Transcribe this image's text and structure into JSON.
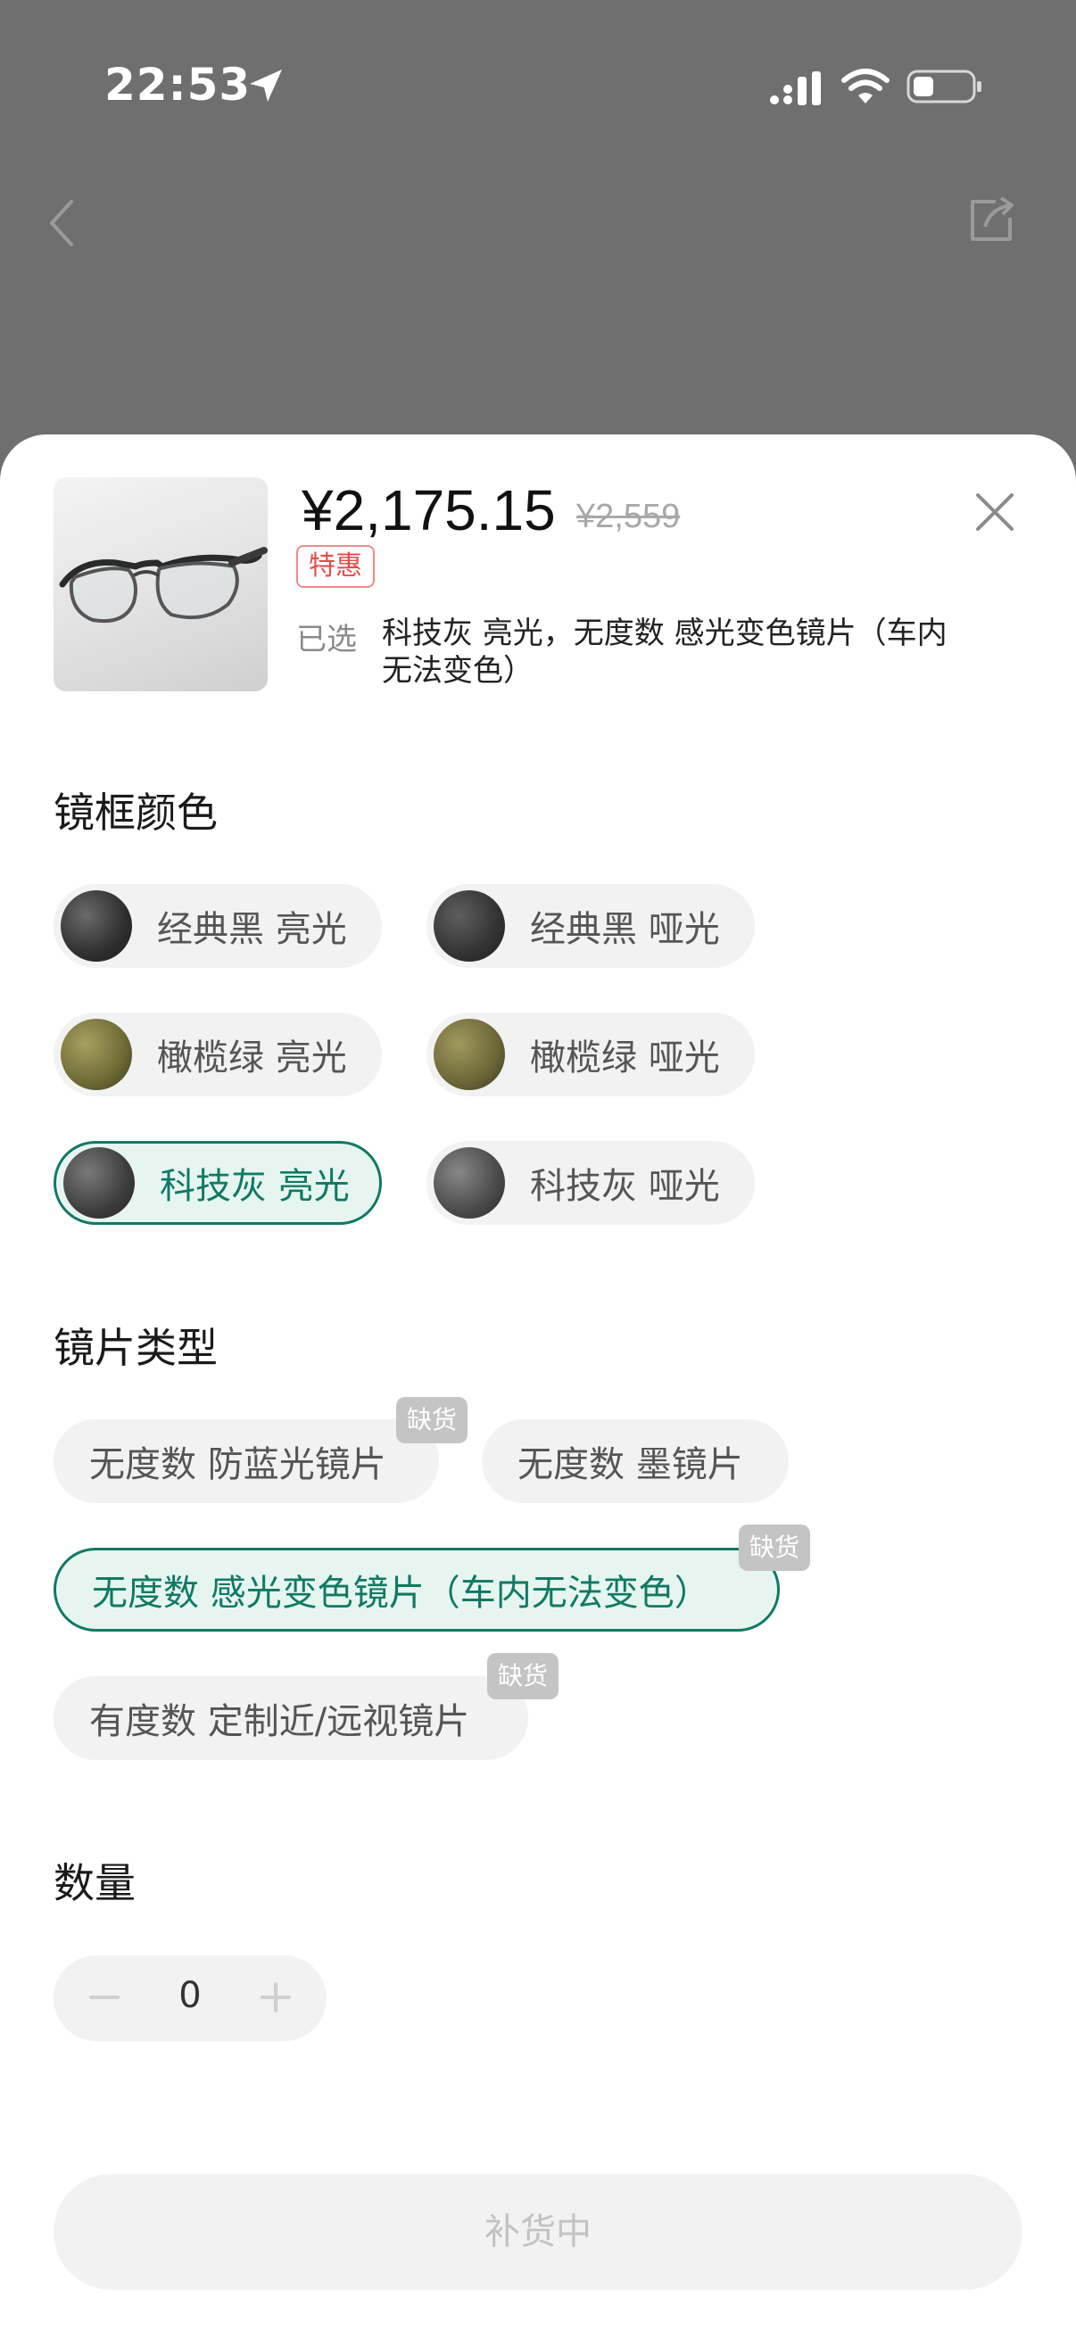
{
  "status_bar": {
    "time": "22:53"
  },
  "colors": {
    "accent": "#0f7a62",
    "accent_bg": "#e7f5f1",
    "deal": "#e84b4b",
    "overlay": "#6f6f6f"
  },
  "product": {
    "price": "¥2,175.15",
    "original_price": "¥2,559",
    "deal_badge": "特惠",
    "selected_label": "已选",
    "selected_value": "科技灰 亮光，无度数 感光变色镜片（车内无法变色）"
  },
  "frame_color": {
    "title": "镜框颜色",
    "options": [
      {
        "label": "经典黑 亮光",
        "swatch": "#2f2f2f",
        "selected": false
      },
      {
        "label": "经典黑 哑光",
        "swatch": "#333333",
        "selected": false
      },
      {
        "label": "橄榄绿 亮光",
        "swatch": "#6d6a35",
        "selected": false
      },
      {
        "label": "橄榄绿 哑光",
        "swatch": "#6b6636",
        "selected": false
      },
      {
        "label": "科技灰 亮光",
        "swatch": "#3d3d3d",
        "selected": true
      },
      {
        "label": "科技灰 哑光",
        "swatch": "#4a4a4a",
        "selected": false
      }
    ]
  },
  "lens_type": {
    "title": "镜片类型",
    "options": [
      {
        "label": "无度数 防蓝光镜片",
        "out_of_stock": "缺货",
        "selected": false
      },
      {
        "label": "无度数 墨镜片",
        "selected": false
      },
      {
        "label": "无度数 感光变色镜片（车内无法变色）",
        "out_of_stock": "缺货",
        "selected": true
      },
      {
        "label": "有度数 定制近/远视镜片",
        "out_of_stock": "缺货",
        "selected": false
      }
    ]
  },
  "quantity": {
    "title": "数量",
    "value": "0"
  },
  "action": {
    "label": "补货中"
  },
  "icons": [
    "location-arrow-icon",
    "signal-icon",
    "wifi-icon",
    "battery-icon",
    "back-icon",
    "share-icon",
    "close-icon",
    "minus-icon",
    "plus-icon"
  ]
}
